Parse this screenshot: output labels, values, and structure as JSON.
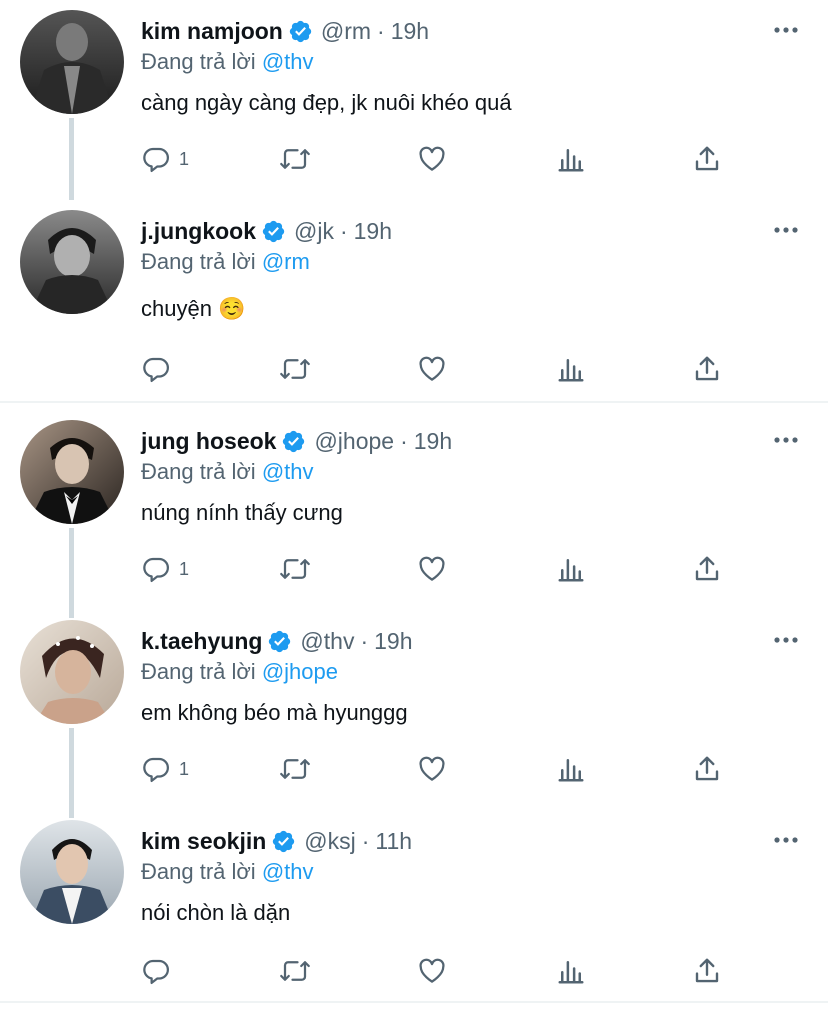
{
  "tweets": [
    {
      "name": "kim namjoon",
      "handle": "@rm",
      "time": "19h",
      "reply_prefix": "Đang trả lời",
      "reply_to": "@thv",
      "text": "càng ngày càng đẹp, jk nuôi khéo quá",
      "reply_count": "1",
      "avatar_colors": [
        "#3a3a3a",
        "#1c1c1c"
      ]
    },
    {
      "name": "j.jungkook",
      "handle": "@jk",
      "time": "19h",
      "reply_prefix": "Đang trả lời",
      "reply_to": "@rm",
      "text": "chuyện ☺️",
      "reply_count": "",
      "avatar_colors": [
        "#6a6a6a",
        "#2a2a2a"
      ]
    },
    {
      "name": "jung hoseok",
      "handle": "@jhope",
      "time": "19h",
      "reply_prefix": "Đang trả lời",
      "reply_to": "@thv",
      "text": "núng nính thấy cưng",
      "reply_count": "1",
      "avatar_colors": [
        "#8a7a70",
        "#1a1a1a"
      ]
    },
    {
      "name": "k.taehyung",
      "handle": "@thv",
      "time": "19h",
      "reply_prefix": "Đang trả lời",
      "reply_to": "@jhope",
      "text": "em không béo mà hyunggg",
      "reply_count": "1",
      "avatar_colors": [
        "#d9cfc4",
        "#5a3a30"
      ]
    },
    {
      "name": "kim seokjin",
      "handle": "@ksj",
      "time": "11h",
      "reply_prefix": "Đang trả lời",
      "reply_to": "@thv",
      "text": "nói chòn là dặn",
      "reply_count": "",
      "avatar_colors": [
        "#c8d0d6",
        "#3a4a5c"
      ]
    }
  ],
  "colors": {
    "verified": "#1d9bf0",
    "mention": "#1d9bf0",
    "icon": "#536471",
    "thread_line": "#cfd9de",
    "divider": "#eff3f4"
  },
  "icons": {
    "reply": "reply-icon",
    "retweet": "retweet-icon",
    "like": "heart-icon",
    "views": "bar-chart-icon",
    "share": "share-icon",
    "verified": "verified-badge-icon",
    "more": "more-options-icon"
  }
}
